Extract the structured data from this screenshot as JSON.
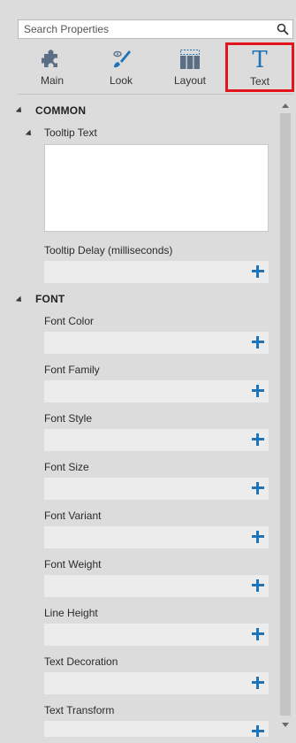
{
  "search": {
    "placeholder": "Search Properties"
  },
  "tabs": [
    {
      "label": "Main",
      "icon": "puzzle-icon",
      "active": false
    },
    {
      "label": "Look",
      "icon": "paintbrush-icon",
      "active": false
    },
    {
      "label": "Layout",
      "icon": "layout-grid-icon",
      "active": false
    },
    {
      "label": "Text",
      "icon": "text-T-icon",
      "active": true
    }
  ],
  "sections": {
    "common": {
      "title": "COMMON",
      "tooltip_text": {
        "label": "Tooltip Text",
        "value": ""
      },
      "tooltip_delay": {
        "label": "Tooltip Delay (milliseconds)"
      }
    },
    "font": {
      "title": "FONT",
      "properties": [
        {
          "label": "Font Color"
        },
        {
          "label": "Font Family"
        },
        {
          "label": "Font Style"
        },
        {
          "label": "Font Size"
        },
        {
          "label": "Font Variant"
        },
        {
          "label": "Font Weight"
        },
        {
          "label": "Line Height"
        },
        {
          "label": "Text Decoration"
        },
        {
          "label": "Text Transform"
        }
      ]
    }
  },
  "colors": {
    "accent": "#1f73b7",
    "active_tab_border": "#e3141b",
    "panel_bg": "#dcdcdc"
  }
}
